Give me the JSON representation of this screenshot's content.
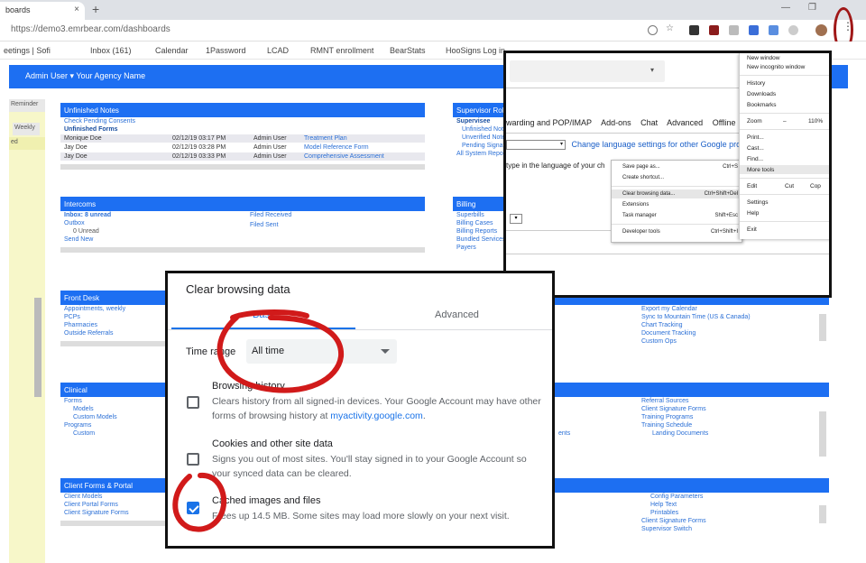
{
  "browser": {
    "tab_title": "boards",
    "url": "https://demo3.emrbear.com/dashboards",
    "bookmarks": [
      "eetings | Sofi",
      "Inbox (161)",
      "Calendar",
      "1Password",
      "LCAD",
      "RMNT enrollment",
      "BearStats",
      "HooSigns Log in"
    ],
    "menu_dots": "⋮",
    "new_tab": "+",
    "close_tab": "×",
    "minimize": "—",
    "restore": "❐",
    "close_window": "✕"
  },
  "app": {
    "header": "Admin User  ▾  Your Agency Name",
    "left_tab": "Reminder",
    "left_tab2": "Weekly",
    "left_tab3": "ed",
    "panels": {
      "unfinished_notes": {
        "title": "Unfinished Notes",
        "link": "Check Pending Consents",
        "subhead": "Unfinished Forms",
        "rows": [
          [
            "Monique Doe",
            "02/12/19 03:17 PM",
            "Admin User",
            "Treatment Plan"
          ],
          [
            "Jay Doe",
            "02/12/19 03:28 PM",
            "Admin User",
            "Model Reference Form"
          ],
          [
            "Jay Doe",
            "02/12/19 03:33 PM",
            "Admin User",
            "Comprehensive Assessment"
          ]
        ]
      },
      "supervisor": {
        "title": "Supervisor Role",
        "items": [
          "Supervisee",
          "Unfinished Notes",
          "Unverified Notes",
          "Pending Signatures",
          "All System Reports"
        ]
      },
      "intercoms": {
        "title": "Intercoms",
        "items": [
          "Inbox: 8 unread",
          "Outbox",
          "0 Unread",
          "Send New"
        ],
        "right_items": [
          "Filed Received",
          "Filed Sent"
        ]
      },
      "billing": {
        "title": "Billing",
        "items": [
          "Superbills",
          "Billing Cases",
          "Billing Reports",
          "Bundled Services",
          "Payers"
        ]
      },
      "front_desk": {
        "title": "Front Desk",
        "items": [
          "Appointments, weekly",
          "PCPs",
          "Pharmacies",
          "Outside Referrals"
        ],
        "right_items": [
          "Export my Calendar",
          "Sync to Mountain Time (US & Canada)",
          "Chart Tracking",
          "Document Tracking",
          "Custom Ops"
        ]
      },
      "clinical": {
        "title": "Clinical",
        "items": [
          "Forms",
          "Models",
          "Custom Models",
          "Programs",
          "Custom"
        ],
        "right_items": [
          "Referral Sources",
          "Client Signature Forms",
          "Training Programs",
          "Training Schedule",
          "Landing Documents"
        ],
        "mid": "ents"
      },
      "client_forms": {
        "title": "Client Forms & Portal",
        "items": [
          "Client Models",
          "Client Portal Forms",
          "Client Signature Forms"
        ],
        "right_items": [
          "Config Parameters",
          "Help Text",
          "Printables",
          "Client Signature Forms",
          "Supervisor Switch"
        ]
      }
    }
  },
  "chrome_menu": {
    "gmail_tabs": [
      "warding and POP/IMAP",
      "Add-ons",
      "Chat",
      "Advanced",
      "Offline"
    ],
    "lang_link": "Change language settings for other Google products",
    "type_text": "type in the language of your ch",
    "select_caret": "▾",
    "main_items": [
      "New window",
      "New incognito window",
      "History",
      "Downloads",
      "Bookmarks",
      "Zoom",
      "Print...",
      "Cast...",
      "Find...",
      "More tools",
      "Edit",
      "Settings",
      "Help",
      "Exit"
    ],
    "zoom_minus": "–",
    "zoom_value": "110%",
    "edit_cut": "Cut",
    "edit_copy": "Cop",
    "sub_items": [
      {
        "label": "Save page as...",
        "shortcut": "Ctrl+S"
      },
      {
        "label": "Create shortcut...",
        "shortcut": ""
      },
      {
        "label": "Clear browsing data...",
        "shortcut": "Ctrl+Shift+Del"
      },
      {
        "label": "Extensions",
        "shortcut": ""
      },
      {
        "label": "Task manager",
        "shortcut": "Shift+Esc"
      },
      {
        "label": "Developer tools",
        "shortcut": "Ctrl+Shift+I"
      }
    ]
  },
  "dialog": {
    "title": "Clear browsing data",
    "tab_basic": "Basic",
    "tab_advanced": "Advanced",
    "time_range_label": "Time range",
    "time_range_value": "All time",
    "items": [
      {
        "title": "Browsing history",
        "desc_before": "Clears history from all signed-in devices. Your Google Account may have other forms of browsing history at ",
        "link": "myactivity.google.com",
        "desc_after": ".",
        "checked": false
      },
      {
        "title": "Cookies and other site data",
        "desc": "Signs you out of most sites. You'll stay signed in to your Google Account so your synced data can be cleared.",
        "checked": false
      },
      {
        "title": "Cached images and files",
        "desc": "Frees up 14.5 MB. Some sites may load more slowly on your next visit.",
        "checked": true
      }
    ]
  },
  "colors": {
    "app_blue": "#1d6ff2",
    "chrome_blue": "#1a73e8",
    "annotation_red": "#d11a1a",
    "menu_circle_red": "#a01818"
  }
}
